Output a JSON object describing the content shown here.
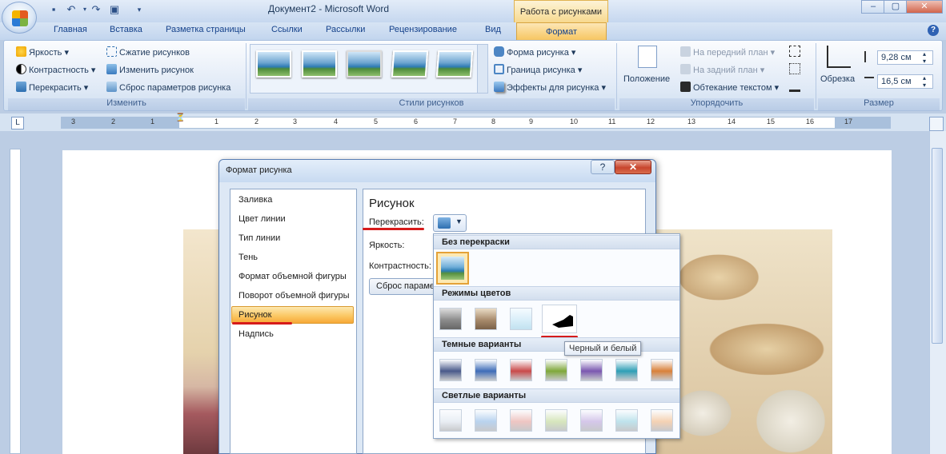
{
  "window": {
    "title": "Документ2 - Microsoft Word",
    "context_tab": "Работа с рисунками"
  },
  "tabs": [
    "Главная",
    "Вставка",
    "Разметка страницы",
    "Ссылки",
    "Рассылки",
    "Рецензирование",
    "Вид",
    "Формат"
  ],
  "ribbon": {
    "adjust": {
      "brightness": "Яркость",
      "contrast": "Контрастность",
      "recolor": "Перекрасить",
      "compress": "Сжатие рисунков",
      "change": "Изменить рисунок",
      "reset": "Сброс параметров рисунка",
      "label": "Изменить"
    },
    "styles": {
      "shape": "Форма рисунка",
      "border": "Граница рисунка",
      "effects": "Эффекты для рисунка",
      "label": "Стили рисунков"
    },
    "arrange": {
      "position": "Положение",
      "front": "На передний план",
      "back": "На задний план",
      "wrap": "Обтекание текстом",
      "label": "Упорядочить"
    },
    "size": {
      "crop": "Обрезка",
      "height": "9,28 см",
      "width": "16,5 см",
      "label": "Размер"
    }
  },
  "ruler": {
    "numbers": [
      "3",
      "2",
      "1",
      "1",
      "2",
      "3",
      "4",
      "5",
      "6",
      "7",
      "8",
      "9",
      "10",
      "11",
      "12",
      "13",
      "14",
      "15",
      "16",
      "17"
    ]
  },
  "dialog": {
    "title": "Формат рисунка",
    "help": "?",
    "close": "✕",
    "nav": [
      "Заливка",
      "Цвет линии",
      "Тип линии",
      "Тень",
      "Формат объемной фигуры",
      "Поворот объемной фигуры",
      "Рисунок",
      "Надпись"
    ],
    "selected_nav": "Рисунок",
    "heading": "Рисунок",
    "recolor_label": "Перекрасить:",
    "brightness_label": "Яркость:",
    "contrast_label": "Контрастность:",
    "reset_button": "Сброс парамет"
  },
  "recolor_menu": {
    "no_recolor": "Без перекраски",
    "color_modes": "Режимы цветов",
    "dark_variants": "Темные варианты",
    "light_variants": "Светлые варианты",
    "tooltip": "Черный и белый"
  },
  "colors": {
    "dark": [
      "#4a5a8a",
      "#3f6db8",
      "#c94a4a",
      "#7fa83a",
      "#7b58b0",
      "#2f9fb6",
      "#d9813a"
    ],
    "light": [
      "#e9eef4",
      "#b9d3ef",
      "#efc6c3",
      "#d7e6bd",
      "#d5c7ea",
      "#bfe3ec",
      "#f5d2b4"
    ]
  }
}
